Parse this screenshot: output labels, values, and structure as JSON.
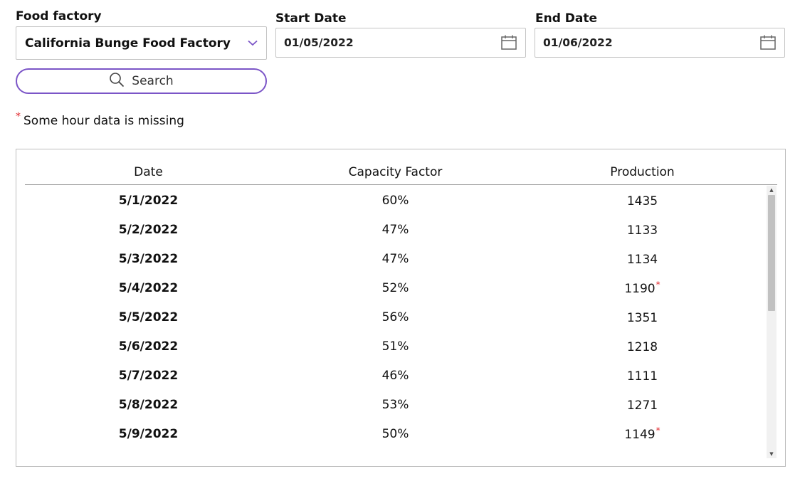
{
  "filters": {
    "factory_label": "Food factory",
    "factory_value": "California Bunge Food Factory",
    "start_label": "Start Date",
    "start_value": "01/05/2022",
    "end_label": "End Date",
    "end_value": "01/06/2022",
    "search_label": "Search"
  },
  "note": {
    "star": "*",
    "text": "Some hour data is missing"
  },
  "table": {
    "headers": [
      "Date",
      "Capacity Factor",
      "Production"
    ],
    "rows": [
      {
        "date": "5/1/2022",
        "capacity": "60%",
        "production": "1435",
        "missing": false
      },
      {
        "date": "5/2/2022",
        "capacity": "47%",
        "production": "1133",
        "missing": false
      },
      {
        "date": "5/3/2022",
        "capacity": "47%",
        "production": "1134",
        "missing": false
      },
      {
        "date": "5/4/2022",
        "capacity": "52%",
        "production": "1190",
        "missing": true
      },
      {
        "date": "5/5/2022",
        "capacity": "56%",
        "production": "1351",
        "missing": false
      },
      {
        "date": "5/6/2022",
        "capacity": "51%",
        "production": "1218",
        "missing": false
      },
      {
        "date": "5/7/2022",
        "capacity": "46%",
        "production": "1111",
        "missing": false
      },
      {
        "date": "5/8/2022",
        "capacity": "53%",
        "production": "1271",
        "missing": false
      },
      {
        "date": "5/9/2022",
        "capacity": "50%",
        "production": "1149",
        "missing": true
      }
    ],
    "missing_marker": "*"
  },
  "icons": {
    "dropdown": "chevron-down-icon",
    "calendar": "calendar-icon",
    "search": "search-icon"
  },
  "colors": {
    "accent": "#7b55c7",
    "missing_star": "#e0262b"
  }
}
